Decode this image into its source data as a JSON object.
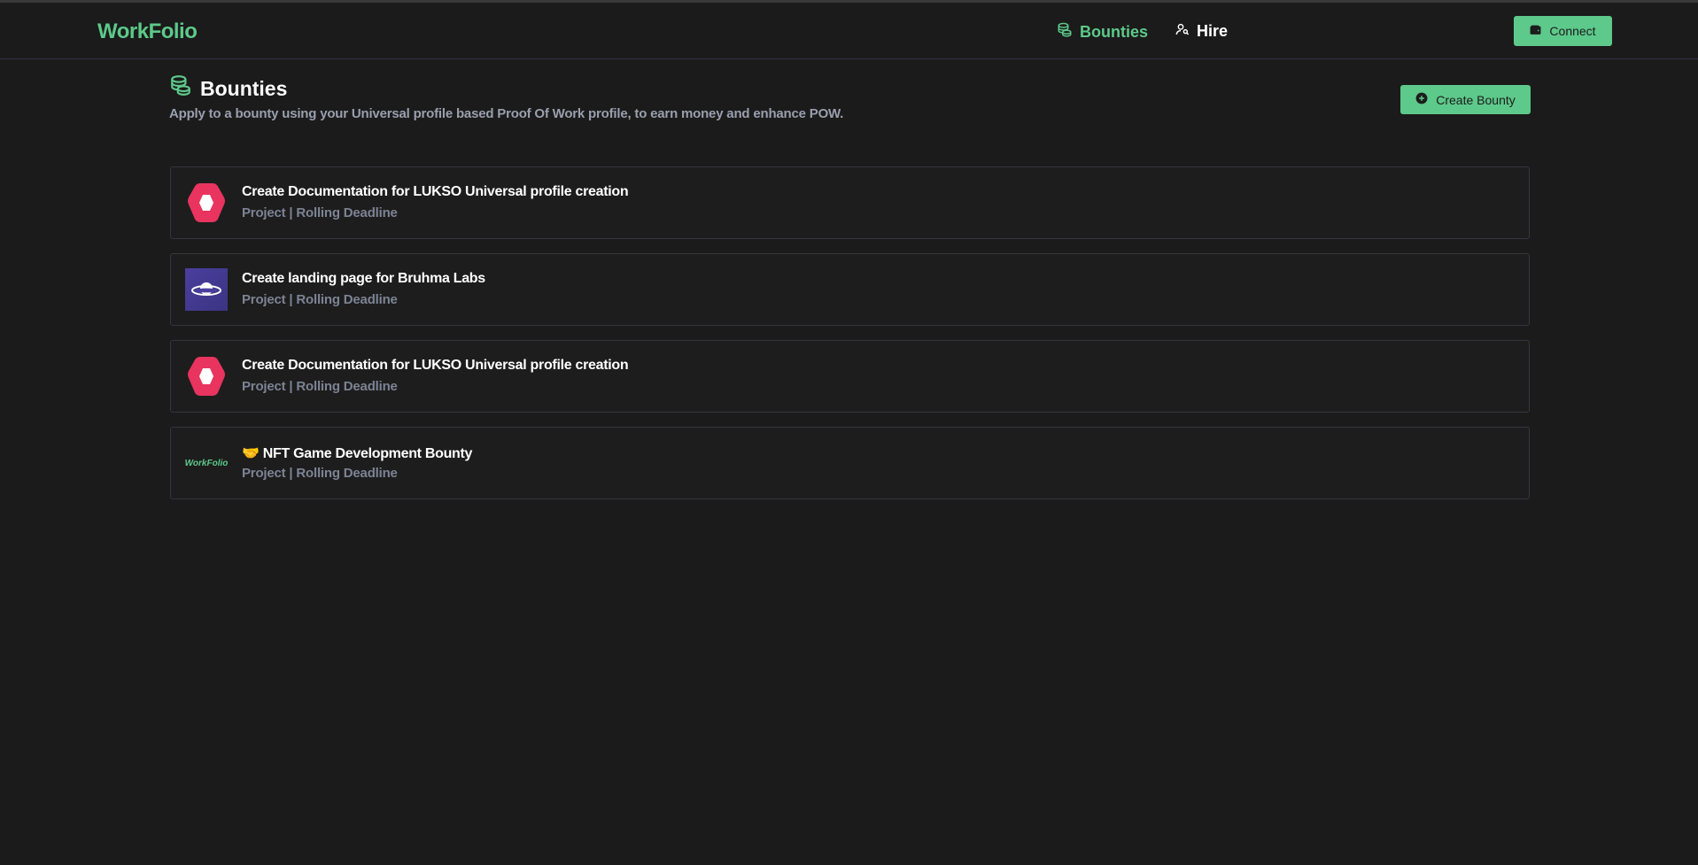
{
  "navbar": {
    "brand": "WorkFolio",
    "links": [
      {
        "label": "Bounties",
        "icon": "coins-stack-icon",
        "active": true
      },
      {
        "label": "Hire",
        "icon": "user-search-icon",
        "active": false
      }
    ],
    "connect_label": "Connect",
    "connect_icon": "wallet-icon"
  },
  "page": {
    "title": "Bounties",
    "title_icon": "coins-stack-icon",
    "subtitle": "Apply to a bounty using your Universal profile based Proof Of Work profile, to earn money and enhance POW.",
    "create_label": "Create Bounty",
    "create_icon": "plus-circle-icon"
  },
  "bounties": [
    {
      "title": "Create Documentation for LUKSO Universal profile creation",
      "meta": "Project | Rolling Deadline",
      "logo": "lukso-hexagon-logo"
    },
    {
      "title": "Create landing page for Bruhma Labs",
      "meta": "Project | Rolling Deadline",
      "logo": "bruhma-planet-logo"
    },
    {
      "title": "Create Documentation for LUKSO Universal profile creation",
      "meta": "Project | Rolling Deadline",
      "logo": "lukso-hexagon-logo"
    },
    {
      "title": "🤝 NFT Game Development Bounty",
      "meta": "Project | Rolling Deadline",
      "logo": "workfolio-logo",
      "logo_text": "WorkFolio"
    }
  ],
  "colors": {
    "accent": "#5dc98a",
    "background": "#1b1b1b",
    "muted_text": "#7c8394",
    "lukso_pink": "#e8345f"
  }
}
